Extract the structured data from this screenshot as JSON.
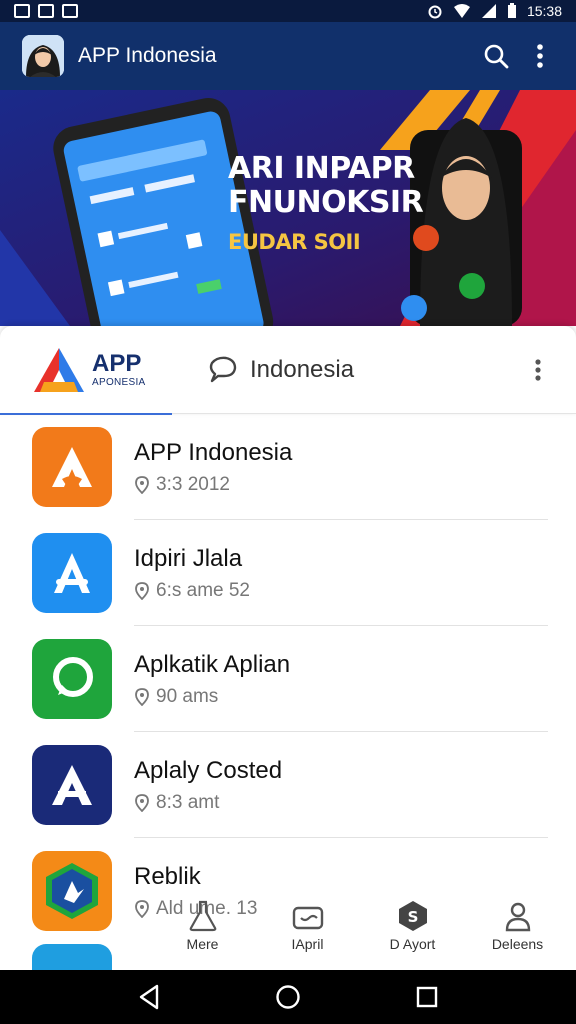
{
  "status_bar": {
    "time": "15:38",
    "left_icons": [
      "notification-icon",
      "gallery-icon",
      "image-icon"
    ],
    "right_icons": [
      "alarm-icon",
      "wifi-icon",
      "signal-icon",
      "battery-icon"
    ]
  },
  "app_bar": {
    "title": "APP Indonesia",
    "actions": [
      "search-icon",
      "more-vert-icon"
    ]
  },
  "banner": {
    "line1": "ARI INPAPR",
    "line2": "FNUNOKSIR",
    "line3": "EUDAR SOII"
  },
  "tabs": {
    "app_title": "APP",
    "app_sub": "APONESIA",
    "indonesia_label": "Indonesia"
  },
  "list": {
    "items": [
      {
        "name": "APP Indonesia",
        "meta": "3:3 2012",
        "icon": "app-indonesia-icon",
        "color": "#f27a1a"
      },
      {
        "name": "Idpiri Jlala",
        "meta": "6:s ame 52",
        "icon": "app-store-icon",
        "color": "#1f8ff0"
      },
      {
        "name": "Aplkatik Aplian",
        "meta": "90 ams",
        "icon": "chat-bubble-icon",
        "color": "#1fa53c"
      },
      {
        "name": "Aplaly Costed",
        "meta": "8:3 amt",
        "icon": "a-letter-icon",
        "color": "#1a2a78"
      },
      {
        "name": "Reblik",
        "meta": "Ald ume. 13",
        "icon": "shield-app-icon",
        "color": "#f48a17"
      }
    ]
  },
  "bottom_nav": {
    "items": [
      {
        "label": "Mere",
        "icon": "flask-icon"
      },
      {
        "label": "IApril",
        "icon": "wallet-icon"
      },
      {
        "label": "D Ayort",
        "icon": "shield-s-icon"
      },
      {
        "label": "Deleens",
        "icon": "person-icon"
      }
    ]
  },
  "system_nav": {
    "buttons": [
      "back-icon",
      "home-icon",
      "recents-icon"
    ]
  },
  "colors": {
    "app_bar": "#11306b",
    "status_bar": "#0a1a3e",
    "accent": "#3a6ed8"
  }
}
